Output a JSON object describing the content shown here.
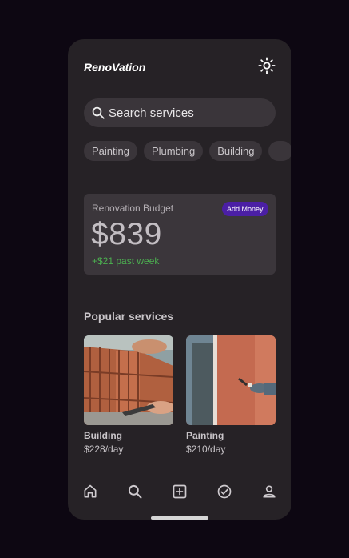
{
  "app": {
    "title": "RenoVation"
  },
  "header": {
    "theme_toggle_icon": "sun-icon"
  },
  "search": {
    "placeholder": "Search services",
    "value": ""
  },
  "chips": [
    {
      "label": "Painting"
    },
    {
      "label": "Plumbing"
    },
    {
      "label": "Building"
    },
    {
      "label": ""
    }
  ],
  "budget": {
    "label": "Renovation Budget",
    "amount": "$839",
    "change": "+$21 past week",
    "add_money_label": "Add Money"
  },
  "popular": {
    "title": "Popular services",
    "cards": [
      {
        "title": "Building",
        "price": "$228/day",
        "image": "brick-wall-photo"
      },
      {
        "title": "Painting",
        "price": "$210/day",
        "image": "painting-wall-photo"
      }
    ]
  },
  "nav": {
    "items": [
      {
        "icon": "home-icon"
      },
      {
        "icon": "search-icon"
      },
      {
        "icon": "add-box-icon"
      },
      {
        "icon": "check-circle-icon"
      },
      {
        "icon": "person-icon"
      }
    ]
  },
  "colors": {
    "background": "#0d0712",
    "surface": "#262226",
    "card": "#3b363b",
    "accent": "#4b1fa5",
    "positive": "#4caf50"
  }
}
